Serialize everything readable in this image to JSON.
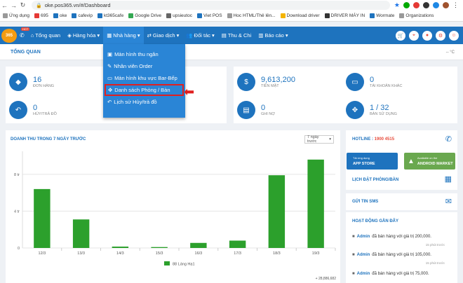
{
  "browser": {
    "url": "oke.pos365.vn/#/Dashboard",
    "bookmarks": [
      "Ứng dụng",
      "695",
      "oke",
      "cafevip",
      "kt365cafe",
      "Google Drive",
      "upsieutoc",
      "Viet POS",
      "Hoc HTML/Thẻ lên...",
      "Download driver",
      "DRIVER MÁY IN",
      "Wormate",
      "Organizations"
    ]
  },
  "nav": {
    "logo": "365",
    "hot": "HOT",
    "menu": [
      "Tổng quan",
      "Hàng hóa",
      "Nhà hàng",
      "Giao dịch",
      "Đối tác",
      "Thu & Chi",
      "Báo cáo"
    ]
  },
  "dropdown": [
    "Màn hình thu ngân",
    "Nhân viên Order",
    "Màn hình khu vực Bar-Bếp",
    "Danh sách Phòng / Bàn",
    "Lịch sử Hủy/trả đồ"
  ],
  "page": {
    "title": "TỔNG QUAN",
    "weather": "-- °C"
  },
  "stats": {
    "orders": {
      "value": "16",
      "label": "ĐƠN HÀNG"
    },
    "returns": {
      "value": "0",
      "label": "HỦY/TRẢ ĐỒ"
    },
    "cash": {
      "value": "9,613,200",
      "label": "TIỀN MẶT"
    },
    "debt": {
      "value": "0",
      "label": "GHI NỢ"
    },
    "other": {
      "value": "0",
      "label": "TÀI KHOẢN KHÁC"
    },
    "tables": {
      "value": "1 / 32",
      "label": "BÀN SỬ DỤNG"
    }
  },
  "chart": {
    "title": "DOANH THU TRONG 7 NGÀY TRƯỚC",
    "period": "7 ngày trước",
    "total": "+ 28,886,682"
  },
  "chart_data": {
    "type": "bar",
    "categories": [
      "12/3",
      "13/3",
      "14/3",
      "15/3",
      "16/3",
      "17/3",
      "18/3",
      "19/3"
    ],
    "series": [
      {
        "name": "88 Láng Hạ1",
        "values": [
          6.4,
          3.1,
          0.15,
          0.1,
          0.55,
          0.8,
          7.9,
          9.6
        ]
      }
    ],
    "yticks": [
      "0",
      "4 tr",
      "8 tr"
    ],
    "ylim": [
      0,
      10.5
    ],
    "color": "#2ca02c"
  },
  "sidebar": {
    "hotline_label": "HOTLINE :",
    "hotline_number": "1900 4515",
    "appstore_small": "Tải ứng dụng",
    "appstore_big": "APP STORE",
    "android_small": "Available on the",
    "android_big": "ANDROID MARKET",
    "booking": "LỊCH ĐẶT PHÒNG/BÀN",
    "sms": "GỬI TIN SMS",
    "recent": "HOẠT ĐỘNG GẦN ĐÂY",
    "activities": [
      {
        "who": "Admin",
        "text": "đã bán hàng với giá trị 200,000.",
        "time": "15 phút trước"
      },
      {
        "who": "Admin",
        "text": "đã bán hàng với giá trị 105,000.",
        "time": "15 phút trước"
      },
      {
        "who": "Admin",
        "text": "đã bán hàng với giá trị 75,000.",
        "time": ""
      }
    ]
  }
}
